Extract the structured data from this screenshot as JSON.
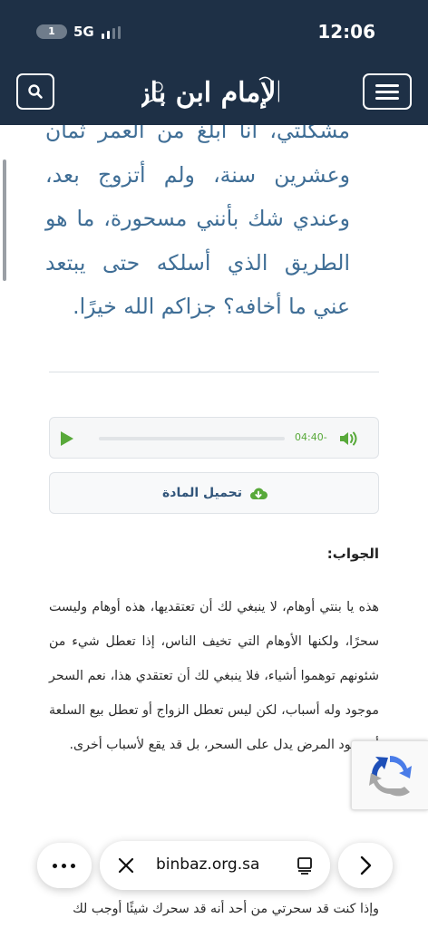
{
  "status_bar": {
    "badge": "1",
    "network": "5G",
    "time": "12:06"
  },
  "header": {
    "logo_text": "الإمام ابن باز",
    "search_icon": "search-icon",
    "menu_icon": "hamburger-menu-icon"
  },
  "question": {
    "text": "مشكلتي، أنا أبلغ من العمر ثمان وعشرين سنة، ولم أتزوج بعد، وعندي شك بأنني مسحورة، ما هو الطريق الذي أسلكه حتى يبتعد عني ما أخافه؟ جزاكم الله خيرًا."
  },
  "audio": {
    "time": "04:40-",
    "progress": 0,
    "play_icon": "play-icon",
    "volume_icon": "volume-icon"
  },
  "download": {
    "label": "تحميل المادة",
    "icon": "cloud-download-icon"
  },
  "answer": {
    "heading": "الجواب:",
    "body": "هذه يا بنتي أوهام، لا ينبغي لك أن تعتقديها، هذه أوهام وليست سحرًا، ولكنها الأوهام التي تخيف الناس، إذا تعطل شيء من شئونهم توهموا أشياء، فلا ينبغي لك أن تعتقدي هذا، نعم السحر موجود وله أسباب، لكن ليس تعطل الزواج أو تعطل بيع السلعة أو وجود المرض يدل على السحر، بل قد يقع لأسباب أخرى.",
    "tail": "وإذا كنت قد سحرتي من أحد أنه قد سحرك شيئًا أوجب لك"
  },
  "browser": {
    "url": "binbaz.org.sa",
    "more_icon": "more-icon",
    "close_icon": "close-icon",
    "reader_icon": "reader-icon",
    "next_icon": "chevron-right-icon"
  },
  "recaptcha": {
    "icon": "recaptcha-icon"
  },
  "colors": {
    "header_bg": "#1e3046",
    "question_text": "#3f6e96",
    "play_green": "#58a93a",
    "download_text": "#31557a"
  }
}
